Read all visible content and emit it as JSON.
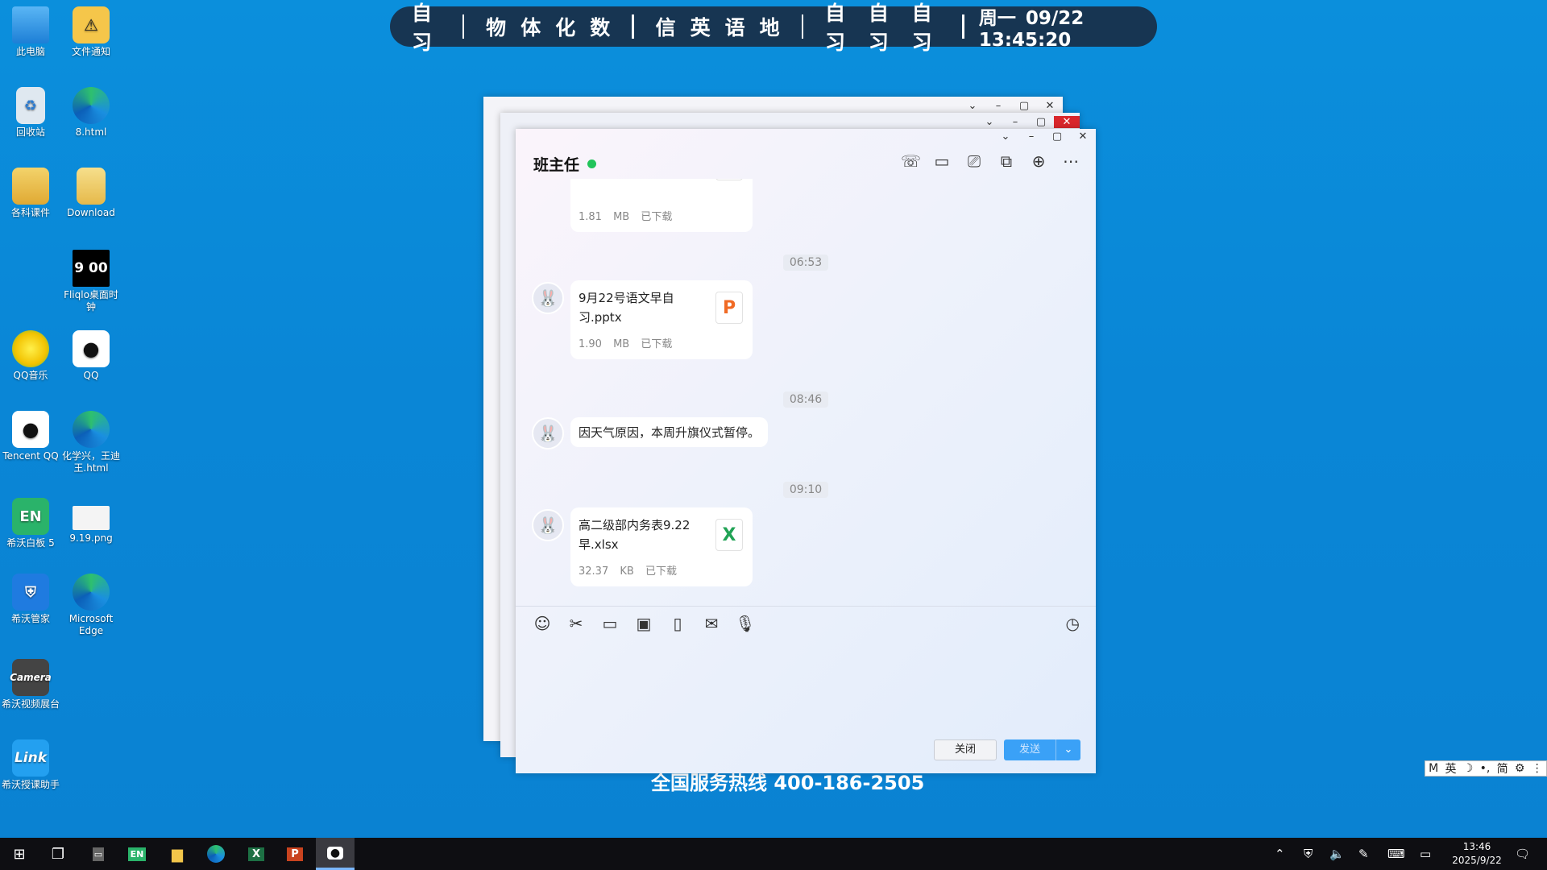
{
  "schedule": {
    "groups": [
      [
        "自习"
      ],
      [
        "物",
        "体",
        "化",
        "数"
      ],
      [
        "信",
        "英",
        "语",
        "地"
      ],
      [
        "自习",
        "自习",
        "自习"
      ]
    ],
    "datetime": "周一 09/22  13:45:20"
  },
  "desktop_icons": [
    {
      "label": "此电脑",
      "icon": "computer-icon"
    },
    {
      "label": "文件通知",
      "icon": "folder-warning-icon"
    },
    {
      "label": "回收站",
      "icon": "recycle-bin-icon"
    },
    {
      "label": "8.html",
      "icon": "edge-icon"
    },
    {
      "label": "各科课件",
      "icon": "folder-icon"
    },
    {
      "label": "Download",
      "icon": "download-file-icon"
    },
    {
      "label": "Fliqlo桌面时钟",
      "icon": "clock-icon",
      "glyph": "9 00"
    },
    {
      "label": "QQ音乐",
      "icon": "qq-music-icon"
    },
    {
      "label": "QQ",
      "icon": "qq-icon"
    },
    {
      "label": "Tencent QQ",
      "icon": "qq-icon"
    },
    {
      "label": "化学兴，王迪王.html",
      "icon": "edge-icon"
    },
    {
      "label": "希沃白板 5",
      "icon": "seewo-board-icon",
      "glyph": "EN"
    },
    {
      "label": "9.19.png",
      "icon": "image-icon"
    },
    {
      "label": "希沃管家",
      "icon": "seewo-shield-icon"
    },
    {
      "label": "Microsoft Edge",
      "icon": "edge-icon"
    },
    {
      "label": "希沃视频展台",
      "icon": "camera-icon",
      "glyph": "Camera"
    },
    {
      "label": "希沃授课助手",
      "icon": "link-icon",
      "glyph": "Link"
    }
  ],
  "chat": {
    "title": "班主任",
    "status_color": "#21c45a",
    "messages": [
      {
        "type": "file",
        "name": "",
        "size": "1.81 MB",
        "state": "已下载",
        "kind": "P"
      },
      {
        "type": "time",
        "text": "06:53"
      },
      {
        "type": "file",
        "name": "9月22号语文早自习.pptx",
        "size": "1.90 MB",
        "state": "已下载",
        "kind": "P"
      },
      {
        "type": "time",
        "text": "08:46"
      },
      {
        "type": "text",
        "text": "因天气原因，本周升旗仪式暂停。"
      },
      {
        "type": "time",
        "text": "09:10"
      },
      {
        "type": "file",
        "name": "高二级部内务表9.22早.xlsx",
        "size": "32.37 KB",
        "state": "已下载",
        "kind": "X"
      }
    ],
    "close_label": "关闭",
    "send_label": "发送"
  },
  "hotline": "全国服务热线 400-186-2505",
  "ime": {
    "items": [
      "M",
      "英",
      "☽",
      "•,",
      "简",
      "⚙",
      "⋮"
    ]
  },
  "taskbar": {
    "time": "13:46",
    "date": "2025/9/22"
  },
  "colors": {
    "desktop": "#0a88d8",
    "schedule_bar": "#173552",
    "send_button": "#3aa1f7",
    "close_red": "#d9262b"
  }
}
